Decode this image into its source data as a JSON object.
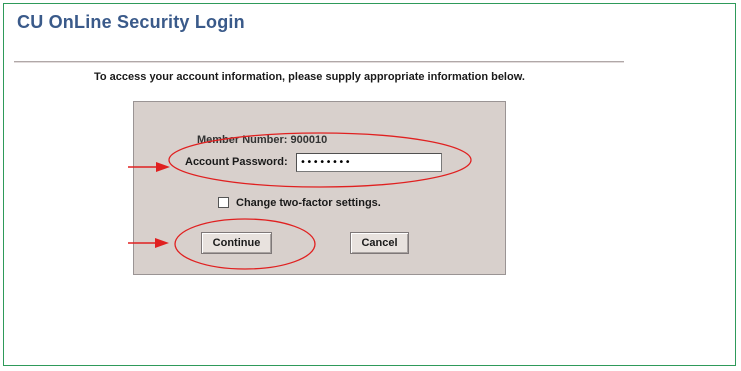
{
  "page": {
    "title": "CU OnLine Security Login",
    "instruction": "To access your account information, please supply appropriate information below."
  },
  "login_form": {
    "member_number_text": "Member Number: 900010",
    "password_label": "Account Password:",
    "password_masked_value": "••••••••",
    "two_factor_label": "Change two-factor settings.",
    "two_factor_checked": false,
    "continue_label": "Continue",
    "cancel_label": "Cancel"
  },
  "annotations": {
    "color": "#e02020",
    "callouts": [
      "password-field",
      "continue-button"
    ]
  },
  "colors": {
    "title": "#3a5a8a",
    "frame_border": "#2e9a5a",
    "panel_bg": "#d8d0cc"
  }
}
